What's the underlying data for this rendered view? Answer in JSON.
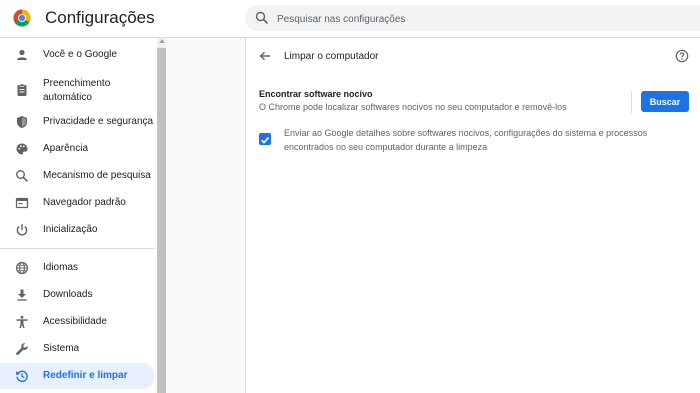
{
  "app": {
    "title": "Configurações",
    "logo_icon": "chrome-logo-icon"
  },
  "search": {
    "placeholder": "Pesquisar nas configurações",
    "icon": "search-icon"
  },
  "sidebar": {
    "items": [
      {
        "label": "Você e o Google",
        "icon": "person-icon"
      },
      {
        "label": "Preenchimento automático",
        "icon": "clipboard-icon"
      },
      {
        "label": "Privacidade e segurança",
        "icon": "shield-icon"
      },
      {
        "label": "Aparência",
        "icon": "palette-icon"
      },
      {
        "label": "Mecanismo de pesquisa",
        "icon": "search-icon"
      },
      {
        "label": "Navegador padrão",
        "icon": "browser-window-icon"
      },
      {
        "label": "Inicialização",
        "icon": "power-icon"
      },
      {
        "label": "Idiomas",
        "icon": "globe-icon"
      },
      {
        "label": "Downloads",
        "icon": "download-icon"
      },
      {
        "label": "Acessibilidade",
        "icon": "accessibility-icon"
      },
      {
        "label": "Sistema",
        "icon": "wrench-icon"
      },
      {
        "label": "Redefinir e limpar",
        "icon": "restore-icon",
        "active": true
      }
    ]
  },
  "page": {
    "title": "Limpar o computador",
    "section_title": "Encontrar software nocivo",
    "section_desc": "O Chrome pode localizar softwares nocivos no seu computador e removê-los",
    "button_label": "Buscar",
    "checkbox_checked": true,
    "checkbox_label": "Enviar ao Google detalhes sobre softwares nocivos, configurações do sistema e processos encontrados no seu computador durante a limpeza"
  },
  "colors": {
    "accent": "#1a73e8",
    "active_bg": "#e8f0fe",
    "text": "#202124",
    "secondary_text": "#5f6368"
  }
}
